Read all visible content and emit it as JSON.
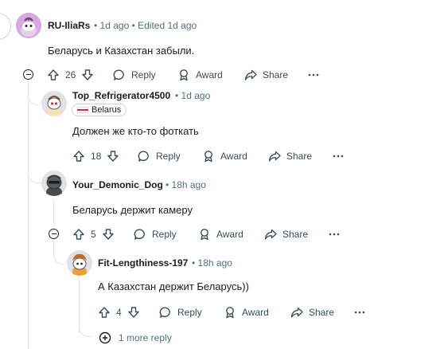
{
  "comments": [
    {
      "author": "RU-IliaRs",
      "meta": "• 1d ago • Edited 1d ago",
      "text": "Беларусь и Казахстан забыли.",
      "votes": "26",
      "reply": "Reply",
      "award": "Award",
      "share": "Share"
    },
    {
      "author": "Top_Refrigerator4500",
      "meta": "• 1d ago",
      "flair": "Belarus",
      "text": "Должен же кто-то фоткать",
      "votes": "18",
      "reply": "Reply",
      "award": "Award",
      "share": "Share"
    },
    {
      "author": "Your_Demonic_Dog",
      "meta": "• 18h ago",
      "text": "Беларусь держит камеру",
      "votes": "5",
      "reply": "Reply",
      "award": "Award",
      "share": "Share"
    },
    {
      "author": "Fit-Lengthiness-197",
      "meta": "• 18h ago",
      "text": "А Казахстан держит Беларусь))",
      "votes": "4",
      "reply": "Reply",
      "award": "Award",
      "share": "Share"
    }
  ],
  "more_replies": "1 more reply",
  "colors": {
    "flag_top": "#ffffff",
    "flag_mid": "#c8313e",
    "flag_bottom": "#ffffff"
  }
}
